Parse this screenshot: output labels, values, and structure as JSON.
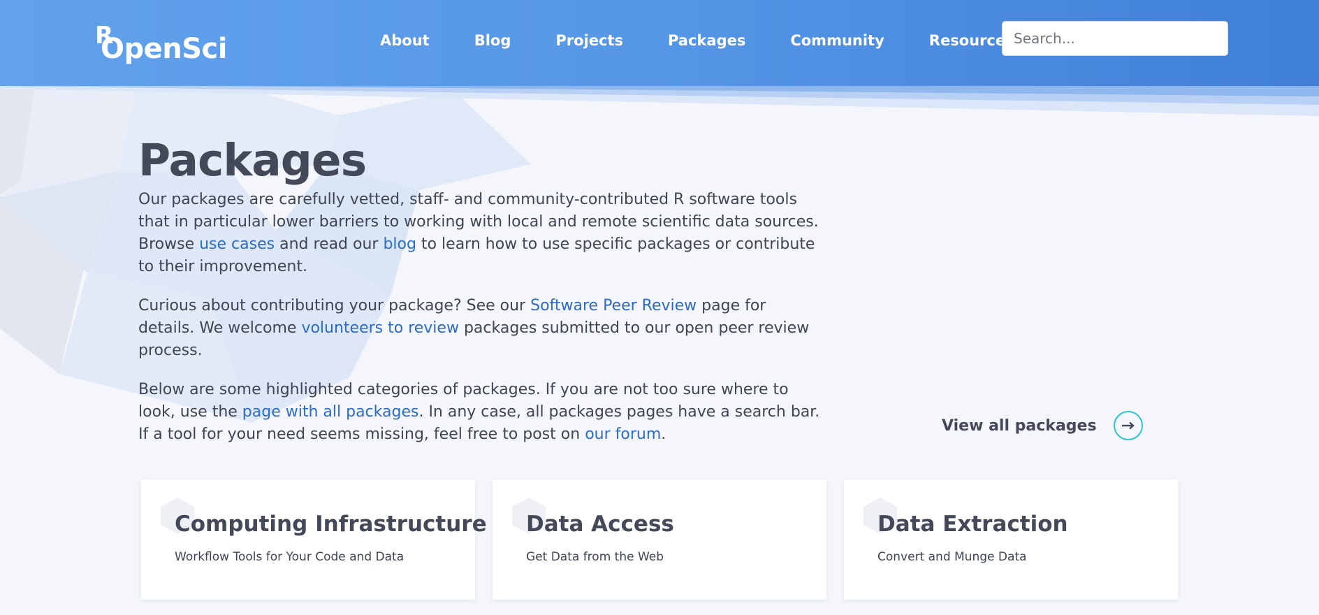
{
  "brand": {
    "logo_r": "R",
    "logo_rest": "OpenSci"
  },
  "nav": {
    "items": [
      {
        "label": "About"
      },
      {
        "label": "Blog"
      },
      {
        "label": "Projects"
      },
      {
        "label": "Packages"
      },
      {
        "label": "Community"
      },
      {
        "label": "Resources"
      }
    ]
  },
  "search": {
    "placeholder": "Search..."
  },
  "page": {
    "title": "Packages",
    "p1": {
      "t1": "Our packages are carefully vetted, staff- and community-contributed R software tools that in particular lower barriers to working with local and remote scientific data sources. Browse ",
      "link1": "use cases",
      "t2": " and read our ",
      "link2": "blog",
      "t3": " to learn how to use specific packages or contribute to their improvement."
    },
    "p2": {
      "t1": "Curious about contributing your package? See our ",
      "link1": "Software Peer Review",
      "t2": " page for details. We welcome ",
      "link2": "volunteers to review",
      "t3": " packages submitted to our open peer review process."
    },
    "p3": {
      "t1": "Below are some highlighted categories of packages. If you are not too sure where to look, use the ",
      "link1": "page with all packages",
      "t2": ". In any case, all packages pages have a search bar. If a tool for your need seems missing, feel free to post on ",
      "link2": "our forum",
      "t3": "."
    }
  },
  "view_all": {
    "label": "View all packages",
    "icon": "arrow-right-icon",
    "accent": "#2cc5cb"
  },
  "cards": [
    {
      "title": "Computing Infrastructure",
      "subtitle": "Workflow Tools for Your Code and Data"
    },
    {
      "title": "Data Access",
      "subtitle": "Get Data from the Web"
    },
    {
      "title": "Data Extraction",
      "subtitle": "Convert and Munge Data"
    }
  ],
  "colors": {
    "header": "#5596e6",
    "link": "#2b6cc4",
    "text": "#3f4554",
    "background": "#f4f6fb"
  }
}
